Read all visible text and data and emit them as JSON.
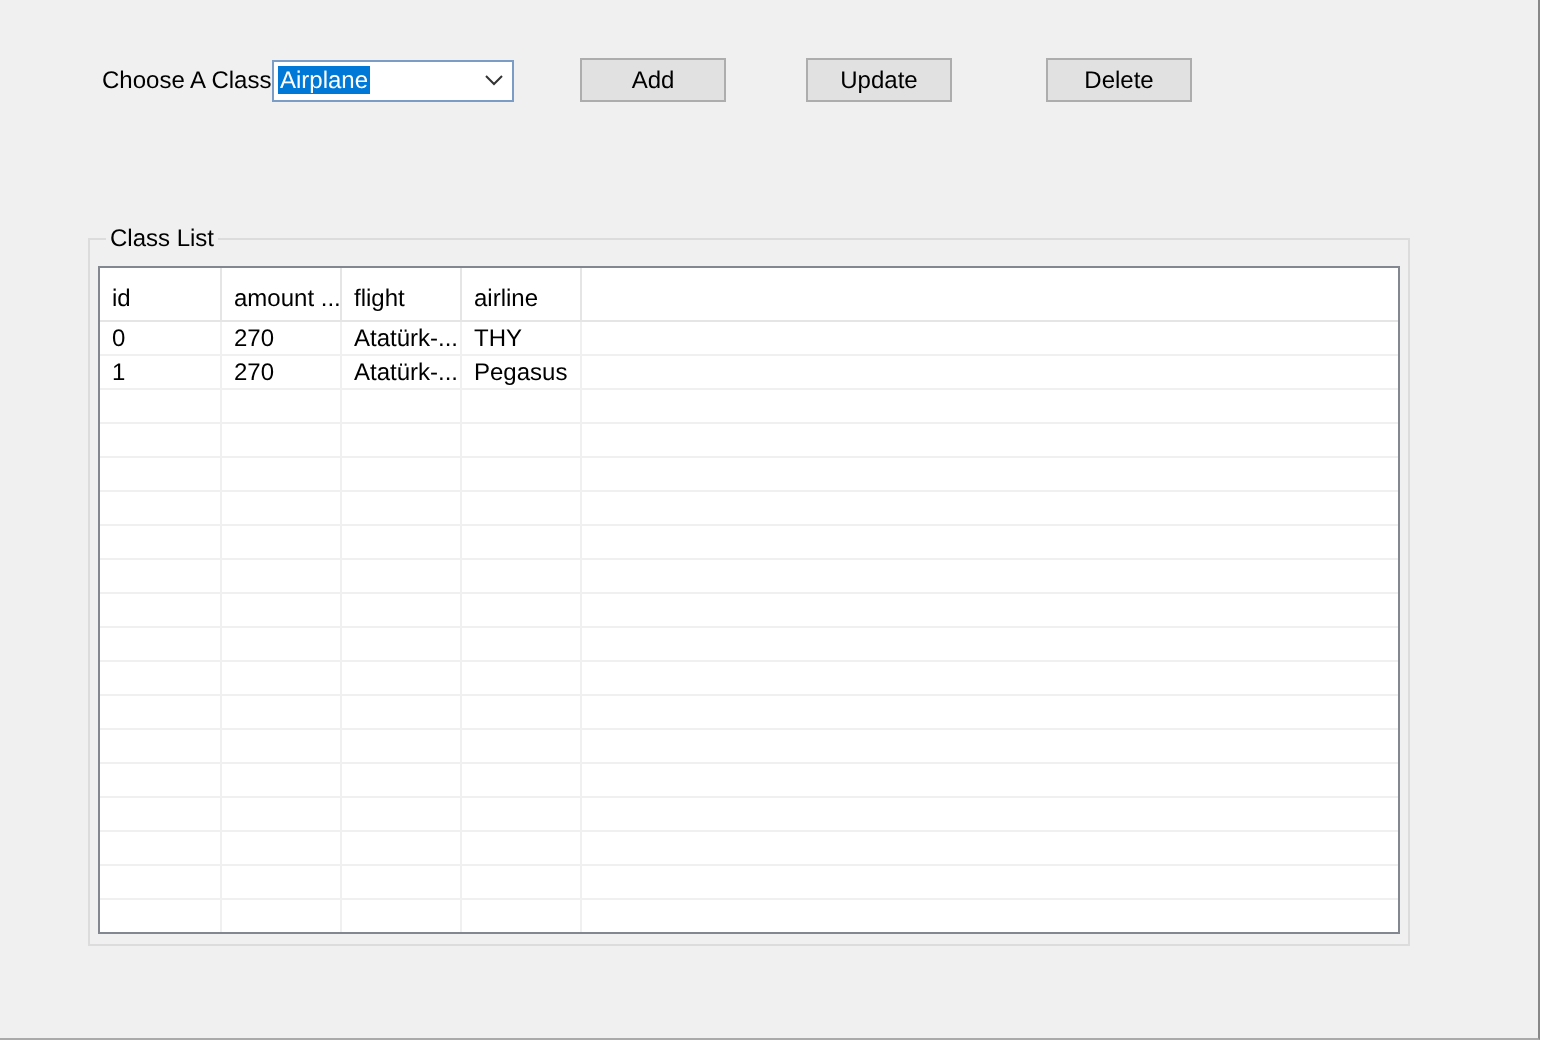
{
  "toolbar": {
    "label": "Choose A Class",
    "combo_value": "Airplane",
    "buttons": [
      "Add",
      "Update",
      "Delete"
    ]
  },
  "class_list": {
    "title": "Class List",
    "columns": [
      "id",
      "amount ...",
      "flight",
      "airline"
    ],
    "rows": [
      [
        "0",
        "270",
        "Atatürk-...",
        "THY"
      ],
      [
        "1",
        "270",
        "Atatürk-...",
        "Pegasus"
      ]
    ]
  }
}
